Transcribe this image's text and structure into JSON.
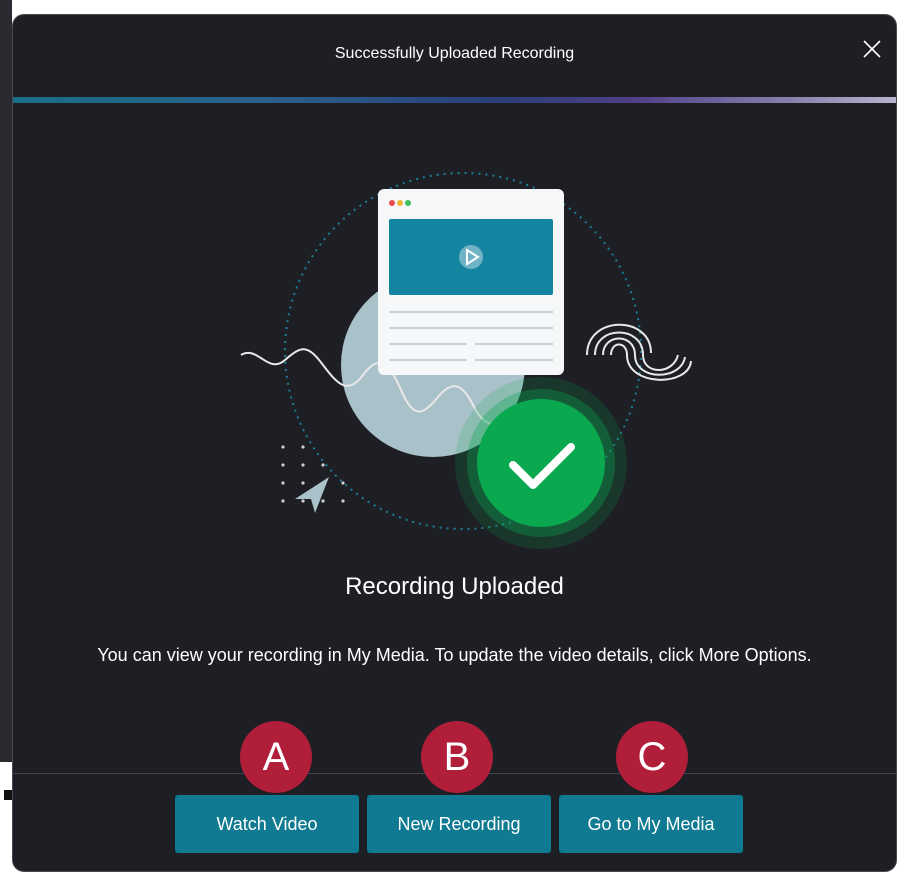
{
  "modal": {
    "title": "Successfully Uploaded Recording",
    "close_icon": "close-icon",
    "heading": "Recording Uploaded",
    "message": "You can view your recording in My Media. To update the video details, click More Options."
  },
  "buttons": {
    "watch_video": "Watch Video",
    "new_recording": "New Recording",
    "go_to_my_media": "Go to My Media"
  },
  "annotations": {
    "a": "A",
    "b": "B",
    "c": "C"
  },
  "colors": {
    "modal_bg": "#1e1f25",
    "button_bg": "#0f7a91",
    "badge_bg": "#b01e3a",
    "success_green": "#0aa84f"
  },
  "illustration": {
    "icons": [
      "browser-window-icon",
      "play-icon",
      "checkmark-icon",
      "cursor-arrow-icon",
      "wavy-line-icon",
      "concentric-arcs-icon"
    ]
  }
}
